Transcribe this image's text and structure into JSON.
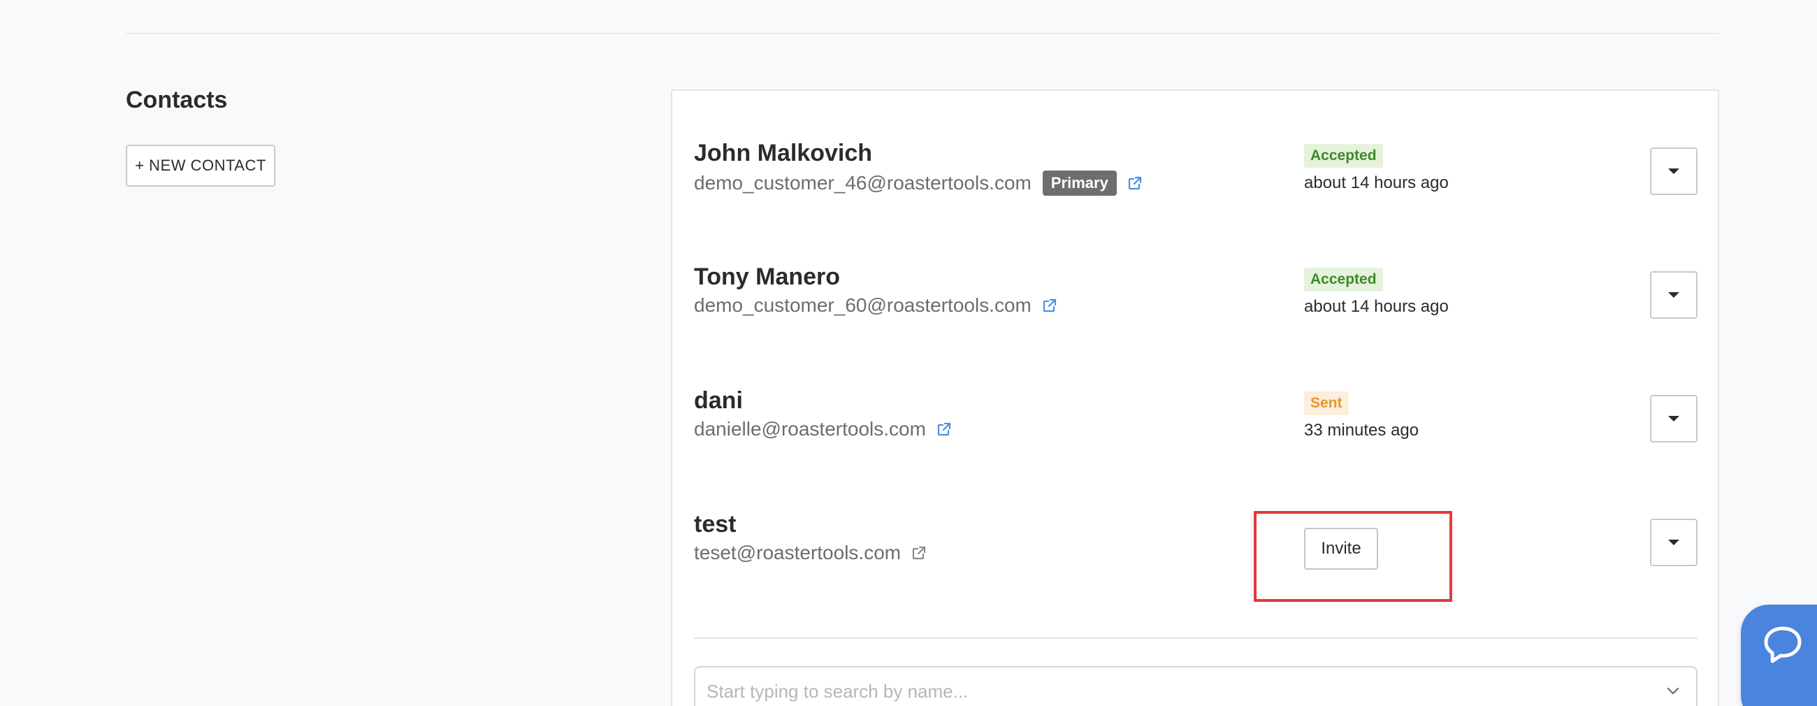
{
  "section": {
    "title": "Contacts",
    "new_contact_label": "+ NEW CONTACT"
  },
  "contacts": [
    {
      "name": "John Malkovich",
      "email": "demo_customer_46@roastertools.com",
      "primary_badge": "Primary",
      "status": "Accepted",
      "status_time": "about 14 hours ago"
    },
    {
      "name": "Tony Manero",
      "email": "demo_customer_60@roastertools.com",
      "status": "Accepted",
      "status_time": "about 14 hours ago"
    },
    {
      "name": "dani",
      "email": "danielle@roastertools.com",
      "status": "Sent",
      "status_time": "33 minutes ago"
    },
    {
      "name": "test",
      "email": "teset@roastertools.com",
      "invite_label": "Invite"
    }
  ],
  "search": {
    "placeholder": "Start typing to search by name..."
  },
  "icons": {
    "external_link": "external-link-icon",
    "dropdown_caret": "caret-down-icon",
    "search_chevron": "chevron-down-icon",
    "chat": "chat-bubble-icon"
  },
  "colors": {
    "accent_blue": "#4a90e2",
    "accepted_text": "#3d8b2a",
    "accepted_bg": "#e5f2dc",
    "sent_text": "#e59a2d",
    "sent_bg": "#fbeedd",
    "primary_badge_bg": "#6e6e6e",
    "highlight_red": "#e5393b",
    "chat_widget_bg": "#4a84de"
  }
}
